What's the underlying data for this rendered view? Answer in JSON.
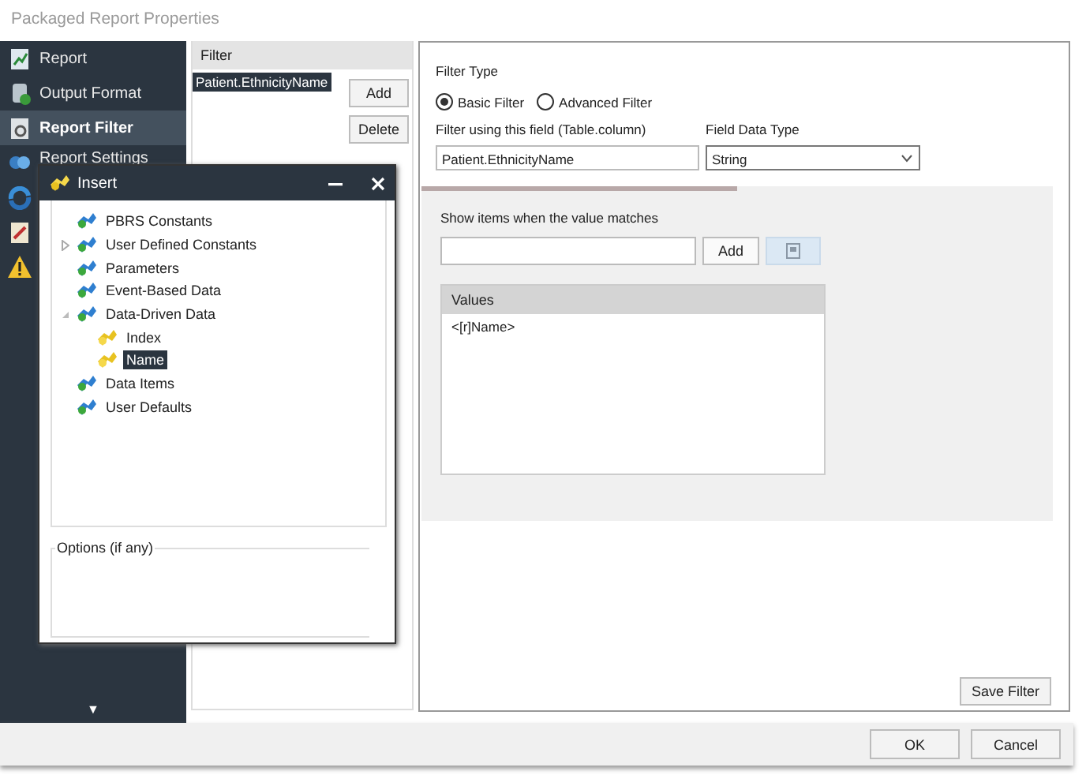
{
  "window": {
    "title": "Packaged Report Properties"
  },
  "sidebar": {
    "items": [
      {
        "label": "Report",
        "selected": false
      },
      {
        "label": "Output Format",
        "selected": false
      },
      {
        "label": "Report Filter",
        "selected": true
      },
      {
        "label": "Report Settings",
        "selected": false
      }
    ],
    "more": "▼"
  },
  "filter_list": {
    "header": "Filter",
    "items": [
      {
        "label": "Patient.EthnicityName",
        "selected": true
      }
    ],
    "buttons": [
      "Add",
      "Delete"
    ]
  },
  "filter_type": {
    "label": "Filter Type",
    "options": [
      {
        "label": "Basic Filter",
        "selected": true
      },
      {
        "label": "Advanced Filter",
        "selected": false
      }
    ]
  },
  "field": {
    "label": "Filter using this field (Table.column)",
    "value": "Patient.EthnicityName"
  },
  "data_type": {
    "label": "Field Data Type",
    "value": "String"
  },
  "match": {
    "label": "Show items when the value matches",
    "button": "Add"
  },
  "values": {
    "header": "Values",
    "rows": [
      "<[r]Name>"
    ]
  },
  "save_button": "Save Filter",
  "buttons": [
    "OK",
    "Cancel"
  ],
  "insert_window": {
    "title": "Insert",
    "tree": [
      {
        "label": "PBRS Constants",
        "kind": "leaf",
        "selected": false
      },
      {
        "label": "User Defined Constants",
        "kind": "branch",
        "expanded": false,
        "selected": false
      },
      {
        "label": "Parameters",
        "kind": "leaf",
        "selected": false
      },
      {
        "label": "Event-Based Data",
        "kind": "leaf",
        "selected": false
      },
      {
        "label": "Data-Driven Data",
        "kind": "branch",
        "expanded": true,
        "selected": false,
        "children": [
          {
            "label": "Index",
            "kind": "leaf",
            "selected": false
          },
          {
            "label": "Name",
            "kind": "leaf",
            "selected": true
          }
        ]
      },
      {
        "label": "Data Items",
        "kind": "leaf",
        "selected": false
      },
      {
        "label": "User Defaults",
        "kind": "leaf",
        "selected": false
      }
    ],
    "options_label": "Options (if any)"
  }
}
